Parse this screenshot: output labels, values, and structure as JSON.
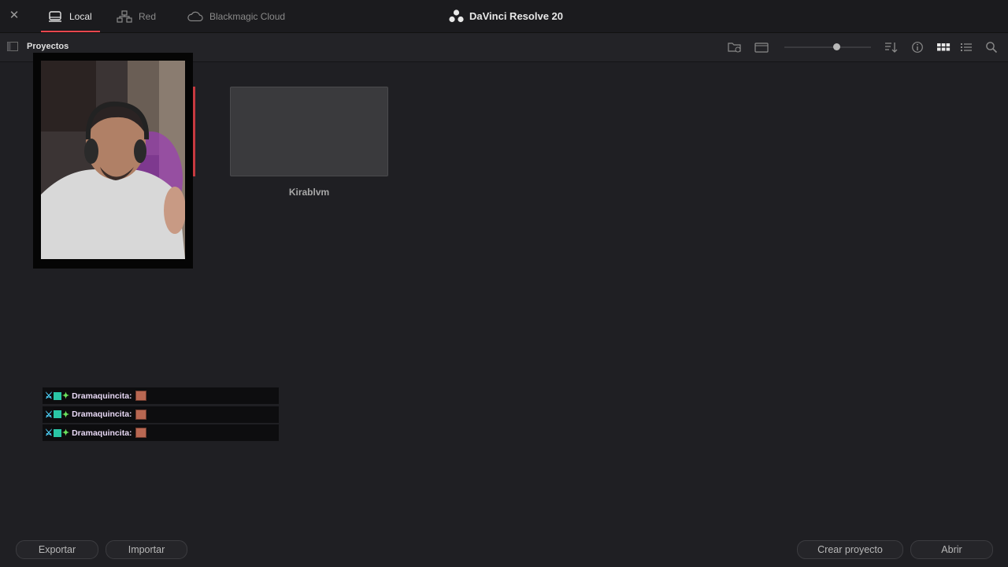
{
  "window": {
    "title": "DaVinci Resolve 20"
  },
  "tabs": [
    {
      "label": "Local",
      "icon": "drive-icon",
      "active": true
    },
    {
      "label": "Red",
      "icon": "network-icon",
      "active": false
    },
    {
      "label": "Blackmagic Cloud",
      "icon": "cloud-icon",
      "active": false
    }
  ],
  "toolbar": {
    "section_title": "Proyectos",
    "thumbnail_size": 0.6,
    "tools": [
      "new-folder-icon",
      "show-folder-icon",
      "sort-icon",
      "info-icon",
      "grid-view-icon",
      "list-view-icon",
      "search-icon"
    ]
  },
  "projects": [
    {
      "name": "Kirablvm"
    }
  ],
  "chat": {
    "messages": [
      {
        "user": "Dramaquincita:"
      },
      {
        "user": "Dramaquincita:"
      },
      {
        "user": "Dramaquincita:"
      }
    ]
  },
  "buttons": {
    "export": "Exportar",
    "import": "Importar",
    "create": "Crear proyecto",
    "open": "Abrir"
  },
  "colors": {
    "accent": "#e8464e",
    "background": "#1f1f23"
  }
}
